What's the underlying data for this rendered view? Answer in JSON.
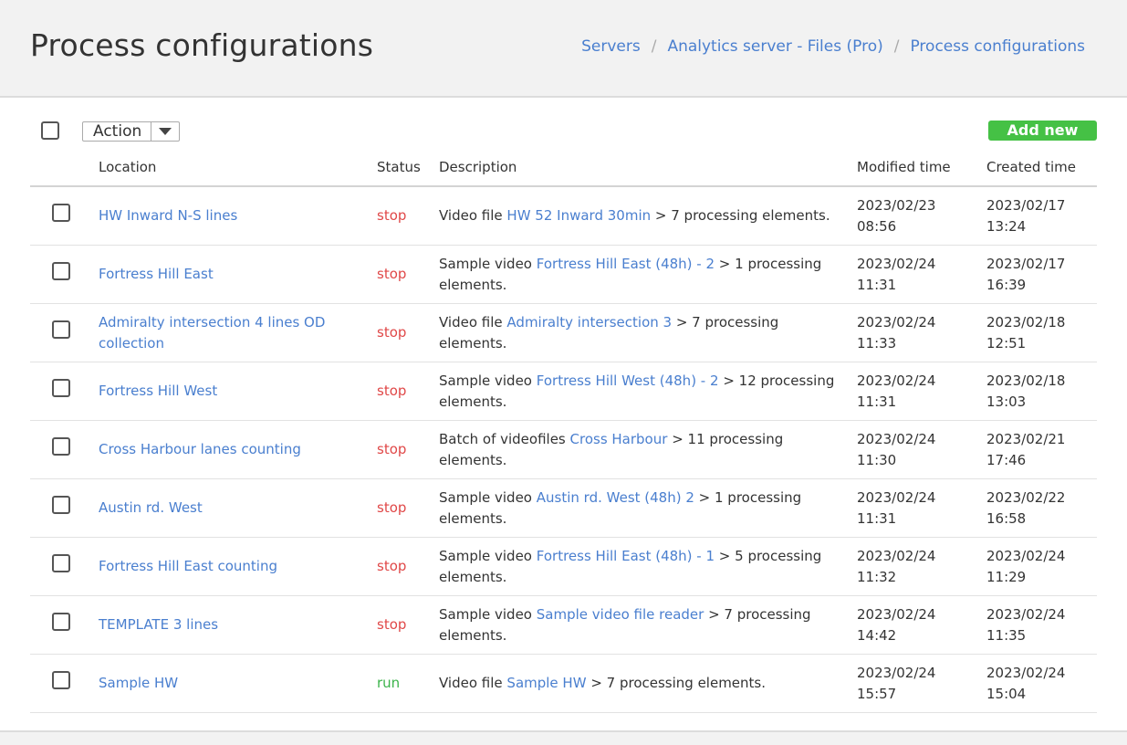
{
  "page": {
    "title": "Process configurations"
  },
  "breadcrumb": [
    {
      "label": "Servers"
    },
    {
      "label": "Analytics server - Files (Pro)"
    },
    {
      "label": "Process configurations"
    }
  ],
  "toolbar": {
    "action_label": "Action",
    "add_new_label": "Add new"
  },
  "table": {
    "headers": {
      "location": "Location",
      "status": "Status",
      "description": "Description",
      "modified": "Modified time",
      "created": "Created time"
    },
    "rows": [
      {
        "location": "HW Inward N-S lines",
        "status": "stop",
        "desc_prefix": "Video file ",
        "desc_link": "HW 52 Inward 30min",
        "desc_suffix": " > 7 processing elements.",
        "modified_date": "2023/02/23",
        "modified_time": "08:56",
        "created_date": "2023/02/17",
        "created_time": "13:24"
      },
      {
        "location": "Fortress Hill East",
        "status": "stop",
        "desc_prefix": "Sample video ",
        "desc_link": "Fortress Hill East (48h) - 2",
        "desc_suffix": " > 1 processing elements.",
        "modified_date": "2023/02/24",
        "modified_time": "11:31",
        "created_date": "2023/02/17",
        "created_time": "16:39"
      },
      {
        "location": "Admiralty intersection 4 lines OD collection",
        "status": "stop",
        "desc_prefix": "Video file ",
        "desc_link": "Admiralty intersection 3",
        "desc_suffix": " > 7 processing elements.",
        "modified_date": "2023/02/24",
        "modified_time": "11:33",
        "created_date": "2023/02/18",
        "created_time": "12:51"
      },
      {
        "location": "Fortress Hill West",
        "status": "stop",
        "desc_prefix": "Sample video ",
        "desc_link": "Fortress Hill West (48h) - 2",
        "desc_suffix": " > 12 processing elements.",
        "modified_date": "2023/02/24",
        "modified_time": "11:31",
        "created_date": "2023/02/18",
        "created_time": "13:03"
      },
      {
        "location": "Cross Harbour lanes counting",
        "status": "stop",
        "desc_prefix": "Batch of videofiles ",
        "desc_link": "Cross Harbour",
        "desc_suffix": " > 11 processing elements.",
        "modified_date": "2023/02/24",
        "modified_time": "11:30",
        "created_date": "2023/02/21",
        "created_time": "17:46"
      },
      {
        "location": "Austin rd. West",
        "status": "stop",
        "desc_prefix": "Sample video ",
        "desc_link": "Austin rd. West (48h) 2",
        "desc_suffix": " > 1 processing elements.",
        "modified_date": "2023/02/24",
        "modified_time": "11:31",
        "created_date": "2023/02/22",
        "created_time": "16:58"
      },
      {
        "location": "Fortress Hill East counting",
        "status": "stop",
        "desc_prefix": "Sample video ",
        "desc_link": "Fortress Hill East (48h) - 1",
        "desc_suffix": " > 5 processing elements.",
        "modified_date": "2023/02/24",
        "modified_time": "11:32",
        "created_date": "2023/02/24",
        "created_time": "11:29"
      },
      {
        "location": "TEMPLATE 3 lines",
        "status": "stop",
        "desc_prefix": "Sample video ",
        "desc_link": "Sample video file reader",
        "desc_suffix": " > 7 processing elements.",
        "modified_date": "2023/02/24",
        "modified_time": "14:42",
        "created_date": "2023/02/24",
        "created_time": "11:35"
      },
      {
        "location": "Sample HW",
        "status": "run",
        "desc_prefix": "Video file ",
        "desc_link": "Sample HW",
        "desc_suffix": " > 7 processing elements.",
        "modified_date": "2023/02/24",
        "modified_time": "15:57",
        "created_date": "2023/02/24",
        "created_time": "15:04"
      }
    ]
  },
  "colors": {
    "link": "#4a7fcf",
    "stop": "#e04848",
    "run": "#3bb34a",
    "add_button": "#45c145",
    "header_bg": "#f2f2f2"
  },
  "icons": {
    "action_dropdown": "caret-down-icon"
  }
}
